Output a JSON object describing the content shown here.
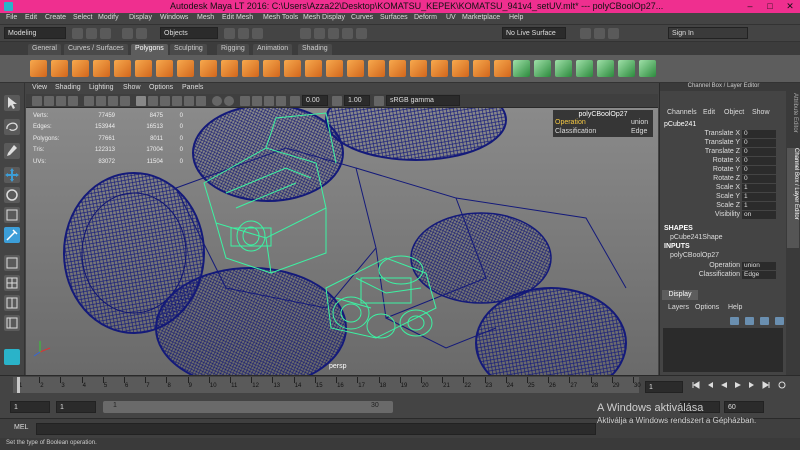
{
  "window": {
    "title": "Autodesk Maya LT 2016: C:\\Users\\Azza22\\Desktop\\KOMATSU_KEPEK\\KOMATSU_941v4_setUV.mlt*   ---   polyCBoolOp27..."
  },
  "menubar": [
    "File",
    "Edit",
    "Create",
    "Select",
    "Modify",
    "Display",
    "Windows",
    "Mesh",
    "Edit Mesh",
    "Mesh Tools",
    "Mesh Display",
    "Curves",
    "Surfaces",
    "Deform",
    "UV",
    "Marketplace",
    "Help"
  ],
  "statusline": {
    "mode": "Modeling",
    "objects": "Objects",
    "live_surface": "No Live Surface",
    "sign_in": "Sign In"
  },
  "shelf_tabs": [
    "General",
    "Curves / Surfaces",
    "Polygons",
    "Sculpting",
    "Rigging",
    "Animation",
    "Shading"
  ],
  "shelf_active": "Polygons",
  "viewport_menu": [
    "View",
    "Shading",
    "Lighting",
    "Show",
    "Options",
    "Panels"
  ],
  "viewport_toolbar": {
    "exposure": "0.00",
    "gamma": "1.00",
    "colorspace": "sRGB gamma"
  },
  "hud": {
    "rows": [
      {
        "label": "Verts:",
        "v1": "77459",
        "v2": "8475",
        "v3": "0"
      },
      {
        "label": "Edges:",
        "v1": "153944",
        "v2": "16513",
        "v3": "0"
      },
      {
        "label": "Polygons:",
        "v1": "77661",
        "v2": "8011",
        "v3": "0"
      },
      {
        "label": "Tris:",
        "v1": "122313",
        "v2": "17004",
        "v3": "0"
      },
      {
        "label": "UVs:",
        "v1": "83072",
        "v2": "11504",
        "v3": "0"
      }
    ]
  },
  "camera_label": "persp",
  "inview_editor": {
    "title": "polyCBoolOp27",
    "rows": [
      {
        "k": "Operation",
        "v": "union"
      },
      {
        "k": "Classification",
        "v": "Edge"
      }
    ]
  },
  "channel_box": {
    "header": "Channel Box / Layer Editor",
    "menu": [
      "Channels",
      "Edit",
      "Object",
      "Show"
    ],
    "object": "pCube241",
    "attrs": [
      {
        "label": "Translate X",
        "value": "0"
      },
      {
        "label": "Translate Y",
        "value": "0"
      },
      {
        "label": "Translate Z",
        "value": "0"
      },
      {
        "label": "Rotate X",
        "value": "0"
      },
      {
        "label": "Rotate Y",
        "value": "0"
      },
      {
        "label": "Rotate Z",
        "value": "0"
      },
      {
        "label": "Scale X",
        "value": "1"
      },
      {
        "label": "Scale Y",
        "value": "1"
      },
      {
        "label": "Scale Z",
        "value": "1"
      },
      {
        "label": "Visibility",
        "value": "on"
      }
    ],
    "shapes_title": "SHAPES",
    "shape_name": "pCube241Shape",
    "inputs_title": "INPUTS",
    "input_name": "polyCBoolOp27",
    "input_attrs": [
      {
        "label": "Operation",
        "value": "union"
      },
      {
        "label": "Classification",
        "value": "Edge"
      }
    ]
  },
  "layer_editor": {
    "tab": "Display",
    "menu": [
      "Layers",
      "Options",
      "Help"
    ]
  },
  "side_tabs": [
    "Attribute Editor",
    "Channel Box / Layer Editor"
  ],
  "timeline": {
    "ticks": [
      "1",
      "2",
      "3",
      "4",
      "5",
      "6",
      "7",
      "8",
      "9",
      "10",
      "11",
      "12",
      "13",
      "14",
      "15",
      "16",
      "17",
      "18",
      "19",
      "20",
      "21",
      "22",
      "23",
      "24",
      "25",
      "26",
      "27",
      "28",
      "29",
      "30"
    ],
    "current_frame": "1"
  },
  "range": {
    "start": "1",
    "start2": "1",
    "slider_start": "1",
    "slider_end": "30",
    "end": "",
    "fps": "60"
  },
  "cmdline": {
    "label": "MEL"
  },
  "help_line": "Set the type of Boolean operation.",
  "watermark": {
    "line1": "A Windows aktiválása",
    "line2": "Aktiválja a Windows rendszert a Gépházban."
  },
  "colors": {
    "titlebar": "#ef2f8f",
    "wire_dark": "#141a7a",
    "wire_selected": "#3cf3a3",
    "shelf_orange": "#e88a2e"
  }
}
